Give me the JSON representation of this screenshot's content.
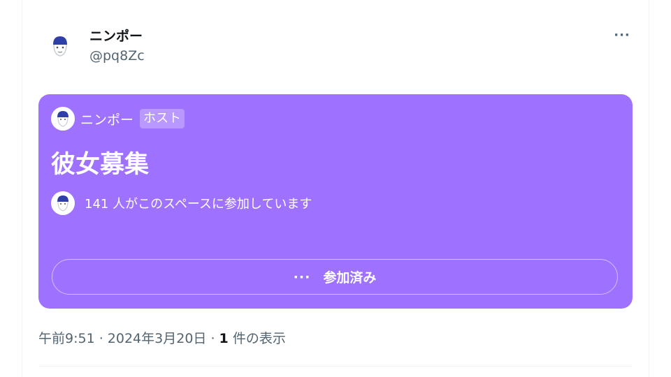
{
  "post": {
    "display_name": "ニンポー",
    "handle": "@pq8Zc",
    "more_label": "···"
  },
  "space": {
    "host_name": "ニンポー",
    "host_badge": "ホスト",
    "title": "彼女募集",
    "listeners_text": "141 人がこのスペースに参加しています",
    "button_dots": "···",
    "button_label": "参加済み",
    "background_color": "#9f71ff"
  },
  "meta": {
    "time": "午前9:51",
    "separator1": " · ",
    "date": "2024年3月20日",
    "separator2": " · ",
    "views_count": "1",
    "views_label": " 件の表示"
  }
}
